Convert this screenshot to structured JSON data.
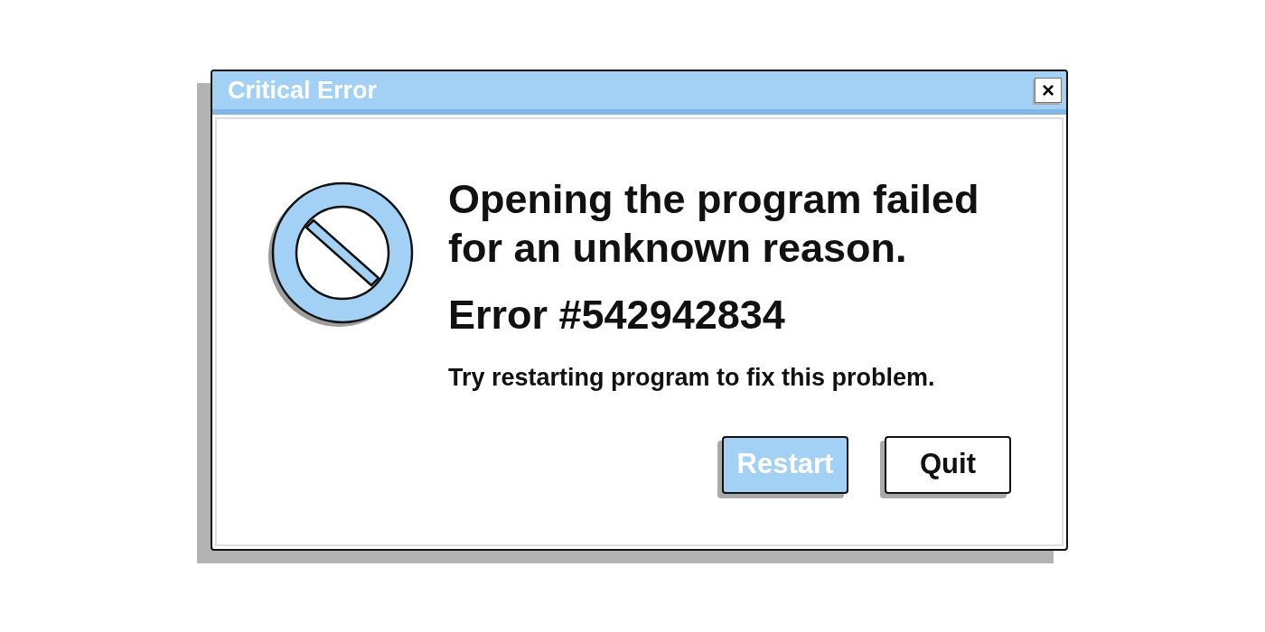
{
  "window": {
    "title": "Critical Error",
    "close": "×"
  },
  "message": {
    "headline": "Opening the program failed for an unknown reason.",
    "code": "Error #542942834",
    "hint": "Try restarting program to fix this problem."
  },
  "buttons": [
    {
      "label": "Restart",
      "kind": "primary"
    },
    {
      "label": "Quit",
      "kind": "secondary"
    }
  ]
}
